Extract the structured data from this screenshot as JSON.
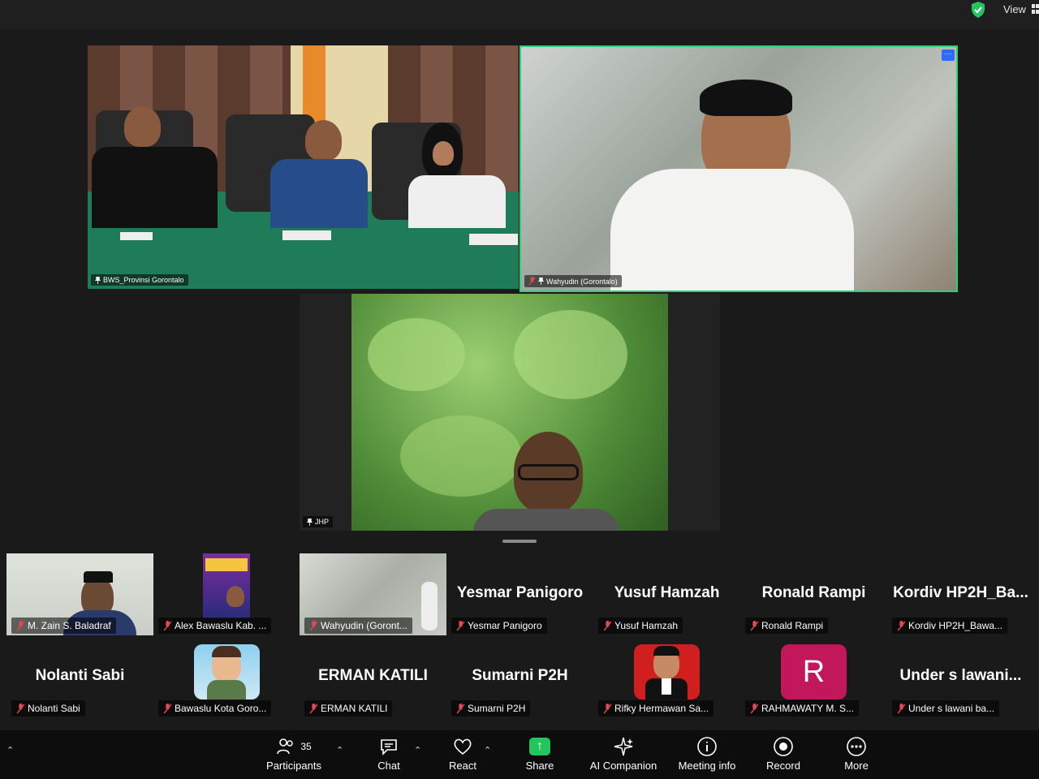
{
  "topbar": {
    "view_label": "View"
  },
  "stage": {
    "tiles": [
      {
        "name": "BWS_Provinsi Gorontalo"
      },
      {
        "name": "Wahyudin (Gorontalo)"
      },
      {
        "name": "JHP"
      }
    ]
  },
  "gallery": {
    "row1": [
      {
        "label": "M. Zain S. Baladraf",
        "big": ""
      },
      {
        "label": "Alex Bawaslu Kab. ...",
        "big": ""
      },
      {
        "label": "Wahyudin (Goront...",
        "big": ""
      },
      {
        "label": "Yesmar Panigoro",
        "big": "Yesmar Panigoro"
      },
      {
        "label": "Yusuf Hamzah",
        "big": "Yusuf Hamzah"
      },
      {
        "label": "Ronald Rampi",
        "big": "Ronald Rampi"
      },
      {
        "label": "Kordiv HP2H_Bawa...",
        "big": "Kordiv  HP2H_Ba..."
      }
    ],
    "row2": [
      {
        "label": "Nolanti Sabi",
        "big": "Nolanti Sabi"
      },
      {
        "label": "Bawaslu Kota Goro...",
        "big": ""
      },
      {
        "label": "ERMAN KATILI",
        "big": "ERMAN KATILI"
      },
      {
        "label": "Sumarni P2H",
        "big": "Sumarni P2H"
      },
      {
        "label": "Rifky Hermawan Sa...",
        "big": ""
      },
      {
        "label": "RAHMAWATY M. S...",
        "big": "",
        "avatar_letter": "R"
      },
      {
        "label": "Under s lawani ba...",
        "big": "Under s lawani..."
      }
    ]
  },
  "toolbar": {
    "participants_label": "Participants",
    "participants_count": "35",
    "chat_label": "Chat",
    "react_label": "React",
    "share_label": "Share",
    "ai_label": "AI Companion",
    "info_label": "Meeting info",
    "record_label": "Record",
    "more_label": "More"
  },
  "colors": {
    "active_speaker": "#2bd17a",
    "share_green": "#22c55e",
    "muted_red": "#e5484d",
    "avatar_pink": "#c2185b"
  }
}
